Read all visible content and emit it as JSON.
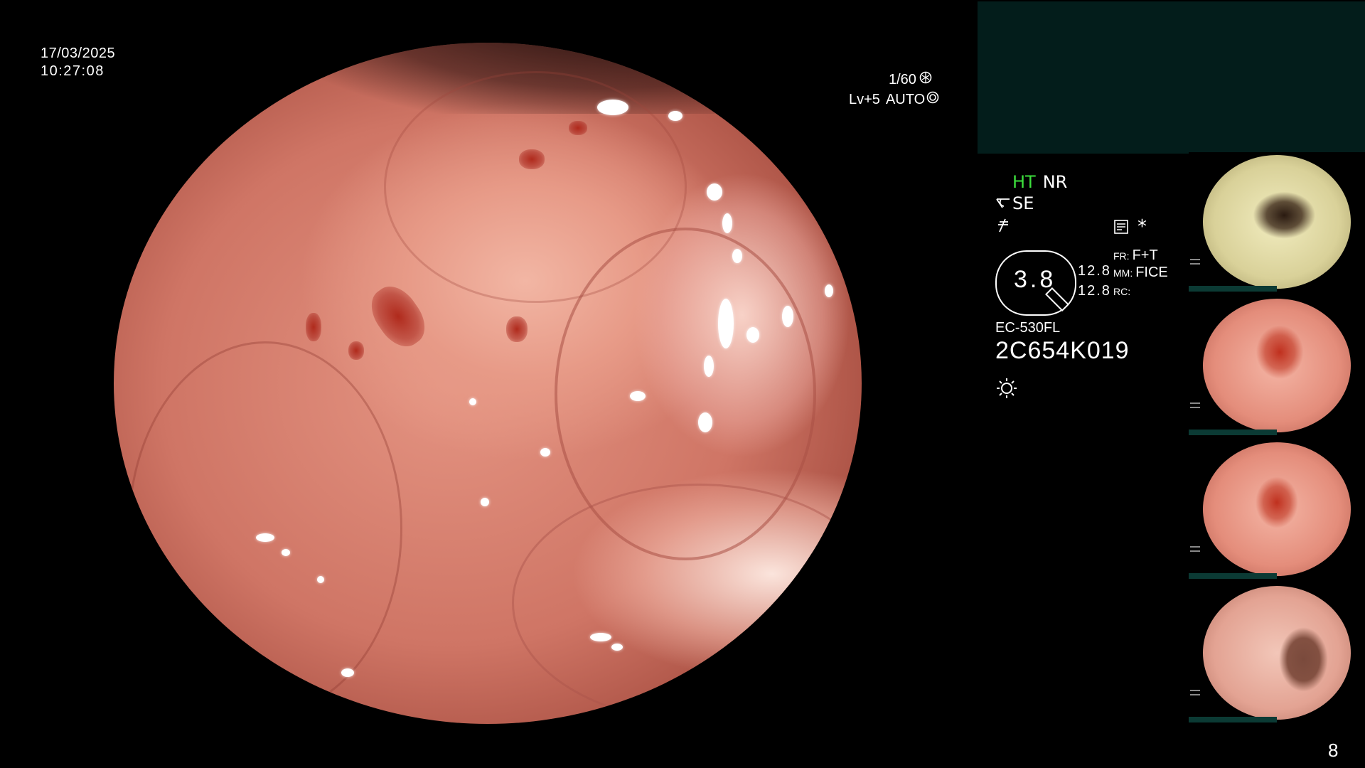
{
  "overlay": {
    "date": "17/03/2025",
    "time": "10:27:08",
    "shutter": "1/60",
    "brightness": "Lv+5",
    "iris_mode": "AUTO",
    "frame_count": "8"
  },
  "status": {
    "ht": "HT",
    "nr": "NR",
    "se": "SE",
    "star": "*",
    "gauge_value": "3.8",
    "fr_label": "FR:",
    "fr_value": "F+T",
    "mm_value_left": "12.8",
    "mm_label": "MM:",
    "mm_value": "FICE",
    "rc_value_left": "12.8",
    "rc_label": "RC:",
    "scope_model": "EC-530FL",
    "serial": "2C654K019"
  },
  "colors": {
    "ht_green": "#3de03d",
    "panel_teal": "#031d1b",
    "thumb_bar": "#0b3a34"
  },
  "icons": [
    "shutter-icon",
    "iris-icon",
    "scissors-icon",
    "no-freeze-icon",
    "record-icon",
    "light-icon"
  ],
  "thumbnails": [
    {
      "label": "capture-1"
    },
    {
      "label": "capture-2"
    },
    {
      "label": "capture-3"
    },
    {
      "label": "capture-4"
    }
  ]
}
